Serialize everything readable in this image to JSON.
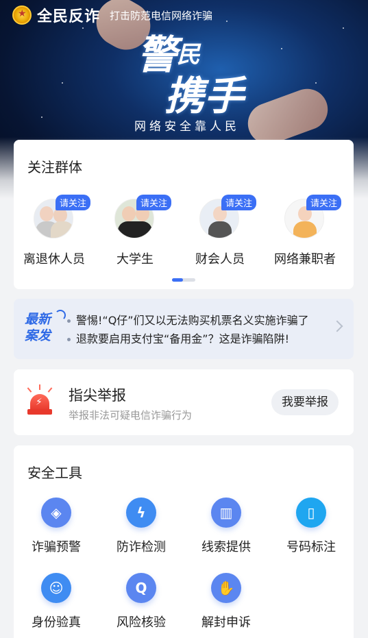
{
  "header": {
    "app_title": "全民反诈",
    "slogan": "打击防范电信网络诈骗"
  },
  "banner": {
    "hero_line1_a": "警",
    "hero_line1_b": "民",
    "hero_line2": "携手",
    "hero_sub": "网络安全靠人民"
  },
  "groups": {
    "title": "关注群体",
    "badge": "请关注",
    "items": [
      {
        "label": "离退休人员",
        "icon": "retirees-avatar"
      },
      {
        "label": "大学生",
        "icon": "students-avatar"
      },
      {
        "label": "财会人员",
        "icon": "accountant-avatar"
      },
      {
        "label": "网络兼职者",
        "icon": "parttime-avatar"
      }
    ]
  },
  "news": {
    "logo_line1": "最新",
    "logo_line2": "案发",
    "items": [
      "警惕!“Q仔”们又以无法购买机票名义实施诈骗了",
      "退款要启用支付宝“备用金”？这是诈骗陷阱!"
    ]
  },
  "report": {
    "title": "指尖举报",
    "subtitle": "举报非法可疑电信诈骗行为",
    "button": "我要举报"
  },
  "tools": {
    "title": "安全工具",
    "items": [
      {
        "label": "诈骗预警",
        "icon": "layers-icon",
        "color": "#5b86f0"
      },
      {
        "label": "防诈检测",
        "icon": "shield-bolt-icon",
        "color": "#3f8cf2"
      },
      {
        "label": "线索提供",
        "icon": "book-icon",
        "color": "#5b86f0"
      },
      {
        "label": "号码标注",
        "icon": "phone-icon",
        "color": "#1fa6f0"
      },
      {
        "label": "身份验真",
        "icon": "id-check-icon",
        "color": "#3f8cf2"
      },
      {
        "label": "风险核验",
        "icon": "magnifier-icon",
        "color": "#5b86f0"
      },
      {
        "label": "解封申诉",
        "icon": "hand-icon",
        "color": "#5b86f0"
      }
    ]
  },
  "colors": {
    "accent": "#3b6ff5",
    "news_bg": "#eaeef7",
    "page_bg": "#f2f3f5"
  }
}
